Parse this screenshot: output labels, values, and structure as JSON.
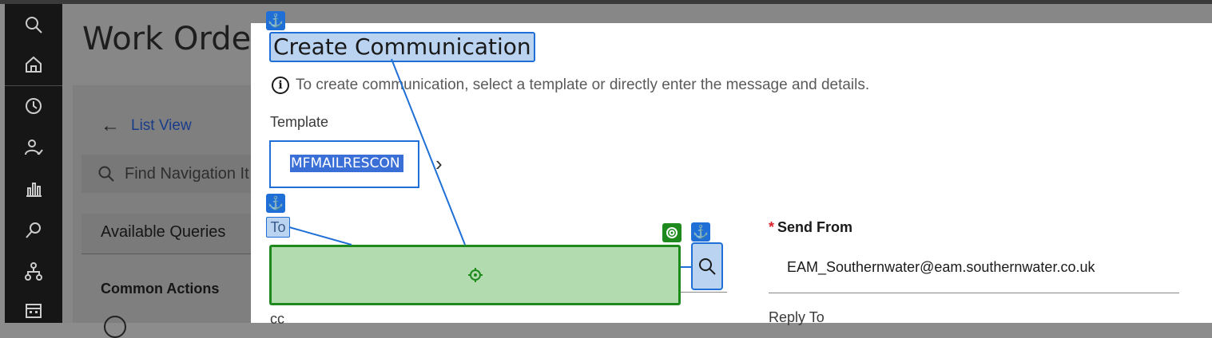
{
  "rail": {
    "items": [
      "search-icon",
      "home-icon",
      "history-icon",
      "user-check-icon",
      "chart-icon",
      "pin-icon",
      "tree-icon",
      "calendar-icon"
    ]
  },
  "background": {
    "page_title": "Work Order",
    "back_label": "List View",
    "nav_search_placeholder": "Find Navigation It",
    "queries_label": "Available Queries",
    "common_actions": "Common Actions"
  },
  "modal": {
    "title": "Create Communication",
    "info_text": "To create communication, select a template or directly enter the message and details.",
    "template_label": "Template",
    "template_value": "MFMAILRESCON",
    "to_label": "To",
    "cc_label": "cc",
    "send_from_label": "Send From",
    "send_from_value": "EAM_Southernwater@eam.southernwater.co.uk",
    "reply_to_label": "Reply To"
  },
  "colors": {
    "accent": "#1f6fd6",
    "annotation_green": "#1e8a1e",
    "required": "#da1e28"
  }
}
